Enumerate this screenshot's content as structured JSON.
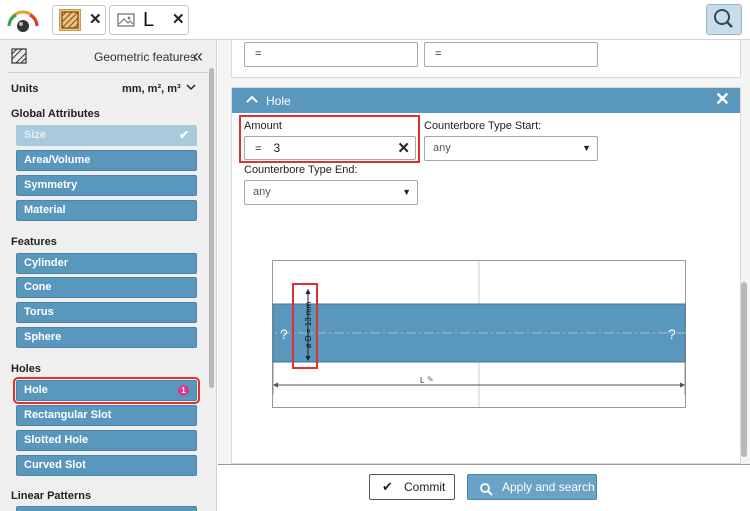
{
  "topbar": {
    "logo_icon": "dial-logo-icon",
    "chip1_icon": "geometric-features-icon",
    "chip2_icon": "image-icon",
    "chip2_symbol": "L",
    "close_symbol": "✕",
    "search_icon": "search-icon"
  },
  "sidebar": {
    "title": "Geometric features",
    "units_label": "Units",
    "units_value": "mm, m², m³",
    "sections": {
      "global": "Global Attributes",
      "features": "Features",
      "holes": "Holes",
      "linear": "Linear Patterns"
    },
    "global_items": [
      "Size",
      "Area/Volume",
      "Symmetry",
      "Material"
    ],
    "feature_items": [
      "Cylinder",
      "Cone",
      "Torus",
      "Sphere"
    ],
    "hole_items": [
      "Hole",
      "Rectangular Slot",
      "Slotted Hole",
      "Curved Slot"
    ],
    "hole_badge": "1"
  },
  "main": {
    "top_fields": [
      "=",
      "="
    ],
    "hole": {
      "title": "Hole",
      "amount_label": "Amount",
      "amount_operator": "=",
      "amount_value": "3",
      "cb_start_label": "Counterbore Type Start:",
      "cb_start_value": "any",
      "cb_end_label": "Counterbore Type End:",
      "cb_end_value": "any"
    },
    "diagram": {
      "q_left": "?",
      "q_right": "?",
      "dim_label": "ø D = 13 mm",
      "length_label": "L"
    }
  },
  "footer": {
    "commit_label": "Commit",
    "apply_label": "Apply and search"
  },
  "colors": {
    "accent": "#5a97bd",
    "highlight": "#e23030",
    "badge": "#d23b8c"
  }
}
